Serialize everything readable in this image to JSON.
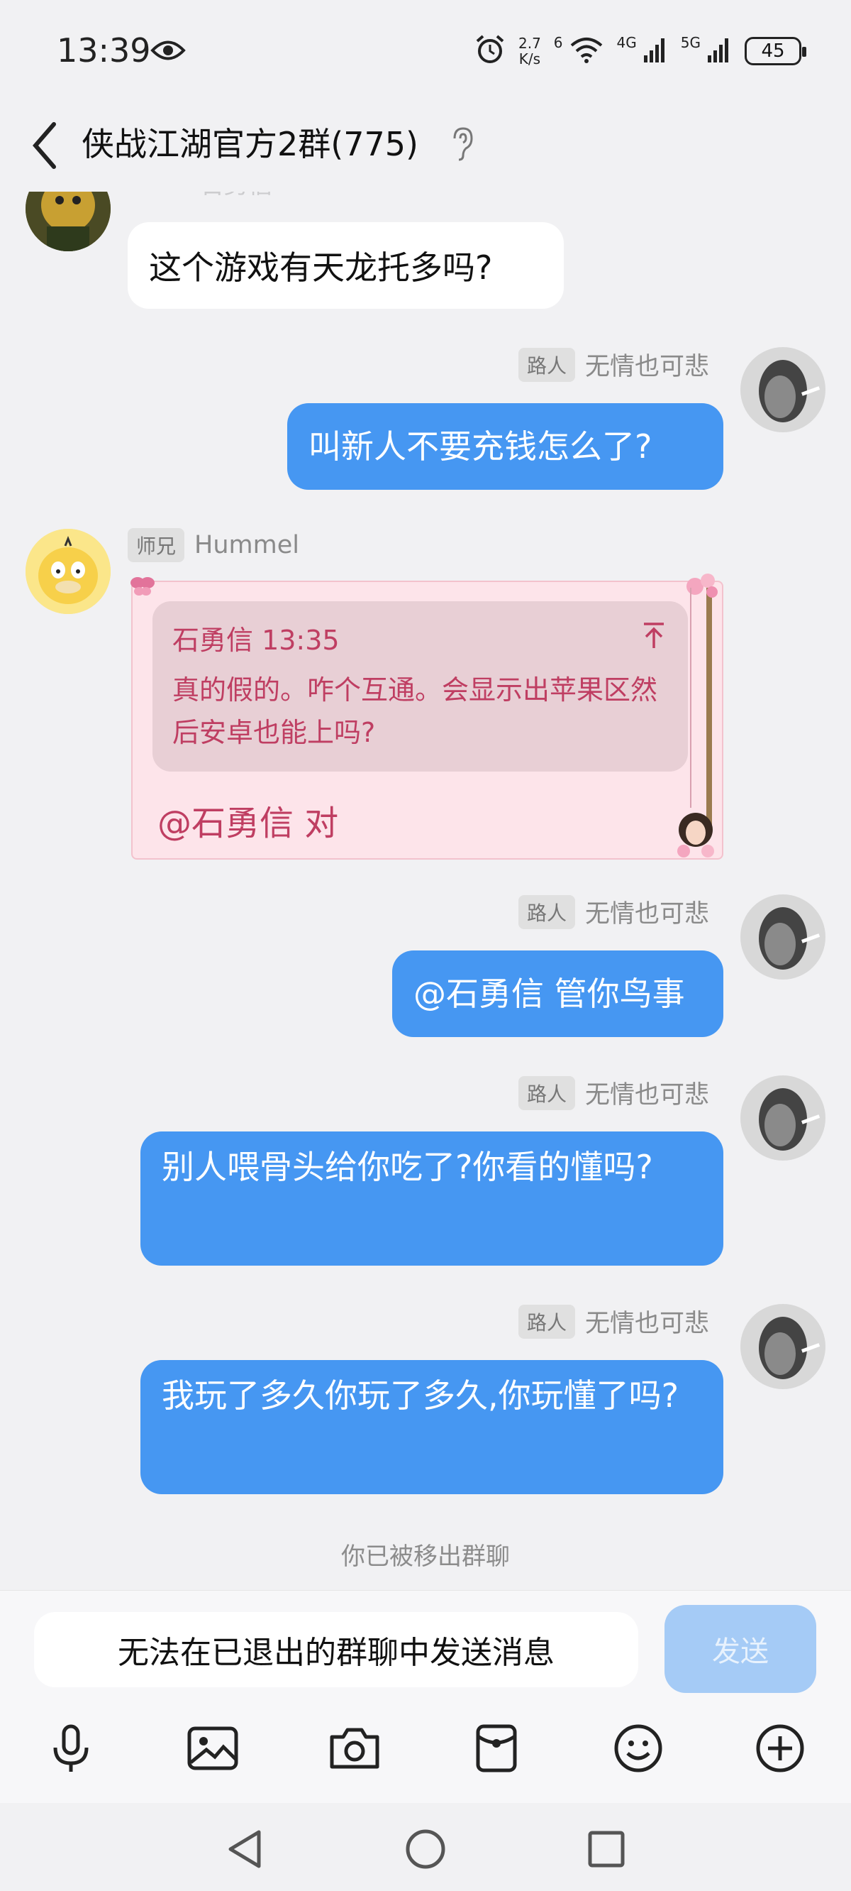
{
  "status_bar": {
    "time": "13:39",
    "speed_value": "2.7",
    "speed_unit": "K/s",
    "wifi_label": "6",
    "net1": "4G",
    "net2": "5G",
    "battery": "45"
  },
  "header": {
    "title": "侠战江湖官方2群(775)"
  },
  "messages": [
    {
      "sender": "石勇信",
      "text": "这个游戏有天龙托多吗?"
    },
    {
      "badge": "路人",
      "sender": "无情也可悲",
      "text": "叫新人不要充钱怎么了?"
    },
    {
      "badge": "师兄",
      "sender": "Hummel",
      "quote_header": "石勇信 13:35",
      "quote_text": "真的假的。咋个互通。会显示出苹果区然后安卓也能上吗?",
      "text": "@石勇信 对"
    },
    {
      "badge": "路人",
      "sender": "无情也可悲",
      "text": "@石勇信 管你鸟事"
    },
    {
      "badge": "路人",
      "sender": "无情也可悲",
      "text": "别人喂骨头给你吃了?你看的懂吗?"
    },
    {
      "badge": "路人",
      "sender": "无情也可悲",
      "text": "我玩了多久你玩了多久,你玩懂了吗?"
    }
  ],
  "system_note": "你已被移出群聊",
  "input": {
    "placeholder": "无法在已退出的群聊中发送消息",
    "send_label": "发送"
  },
  "toolbar_icons": [
    "microphone-icon",
    "image-icon",
    "camera-icon",
    "red-packet-icon",
    "emoji-icon",
    "plus-icon"
  ],
  "colors": {
    "blue_bubble": "#4697f2",
    "send_disabled": "#a5cbf6",
    "quote_text": "#bf3e62",
    "background": "#f1f1f3"
  }
}
